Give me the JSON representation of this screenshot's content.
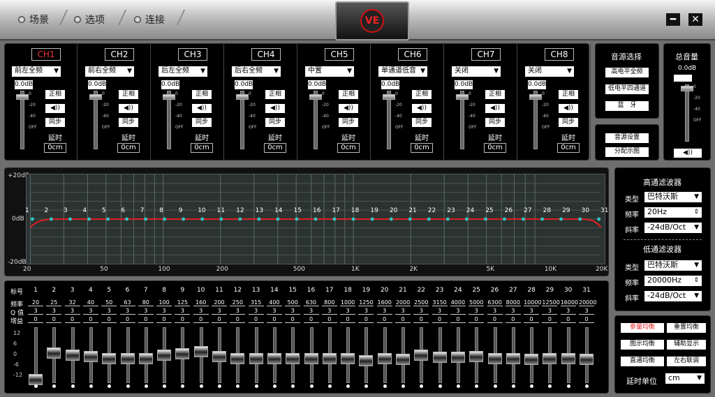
{
  "menu": {
    "items": [
      "场景",
      "选项",
      "连接"
    ]
  },
  "logo_text": "VE",
  "window": {
    "minimize": "━",
    "close": "✕"
  },
  "channels": [
    {
      "name": "CH1",
      "source": "前左全频",
      "db": "0.0dB",
      "selected": true
    },
    {
      "name": "CH2",
      "source": "前右全频",
      "db": "0.0dB",
      "selected": false
    },
    {
      "name": "CH3",
      "source": "后左全频",
      "db": "0.0dB",
      "selected": false
    },
    {
      "name": "CH4",
      "source": "后右全频",
      "db": "0.0dB",
      "selected": false
    },
    {
      "name": "CH5",
      "source": "中置",
      "db": "0.0dB",
      "selected": false
    },
    {
      "name": "CH6",
      "source": "单通道低音",
      "db": "0.0dB",
      "selected": false
    },
    {
      "name": "CH7",
      "source": "关闭",
      "db": "0.0dB",
      "selected": false
    },
    {
      "name": "CH8",
      "source": "关闭",
      "db": "0.0dB",
      "selected": false
    }
  ],
  "channel_buttons": {
    "phase": "正相",
    "mute": "◀))",
    "sync": "同步",
    "delay_label": "延时",
    "delay_value": "0cm"
  },
  "scale": [
    "0",
    "-20",
    "-40",
    "OFF"
  ],
  "source_select": {
    "title": "音源选择",
    "options": [
      "高电平全频",
      "低电平四通道",
      "蓝　牙"
    ]
  },
  "source_extra": [
    "音源设置",
    "分配示图"
  ],
  "master": {
    "title": "总音量",
    "db": "0.0dB",
    "mute": "◀))",
    "scale": [
      "0",
      "-20",
      "-40",
      "OFF"
    ]
  },
  "eq_graph": {
    "y_labels": [
      "+20dB",
      "0dB",
      "-20dB"
    ],
    "x_labels": [
      "20",
      "50",
      "100",
      "200",
      "500",
      "1K",
      "2K",
      "5K",
      "10K",
      "20K"
    ],
    "bands": [
      "1",
      "2",
      "3",
      "4",
      "5",
      "6",
      "7",
      "8",
      "9",
      "10",
      "11",
      "12",
      "13",
      "14",
      "15",
      "16",
      "17",
      "18",
      "19",
      "20",
      "21",
      "22",
      "23",
      "24",
      "25",
      "26",
      "27",
      "28",
      "29",
      "30",
      "31"
    ]
  },
  "highpass": {
    "title": "高通滤波器",
    "type_label": "类型",
    "type": "巴特沃斯",
    "freq_label": "频率",
    "freq": "20Hz",
    "slope_label": "斜率",
    "slope": "-24dB/Oct"
  },
  "lowpass": {
    "title": "低通滤波器",
    "type_label": "类型",
    "type": "巴特沃斯",
    "freq_label": "频率",
    "freq": "20000Hz",
    "slope_label": "斜率",
    "slope": "-24dB/Oct"
  },
  "eq_table": {
    "row_labels": [
      "标号",
      "频率",
      "Q 值",
      "增益"
    ],
    "freqs": [
      "20",
      "25",
      "32",
      "40",
      "50",
      "63",
      "80",
      "100",
      "125",
      "160",
      "200",
      "250",
      "315",
      "400",
      "500",
      "630",
      "800",
      "1000",
      "1250",
      "1600",
      "2000",
      "2500",
      "3150",
      "4000",
      "5000",
      "6300",
      "8000",
      "10000",
      "12500",
      "16000",
      "20000"
    ],
    "q": "3",
    "gain": "0",
    "gain_scale": [
      "12",
      "6",
      "0",
      "-6",
      "-12"
    ],
    "slider_levels": [
      -11,
      1,
      0,
      -0.5,
      -1.5,
      -1.5,
      -1.5,
      0,
      0.5,
      1.5,
      -0.5,
      -1.5,
      -1.5,
      -1.5,
      -1.5,
      -1.5,
      -1.5,
      -1.5,
      -2.5,
      -1.5,
      -2,
      0,
      -1,
      -1,
      -0.5,
      -1.5,
      -1.5,
      -2,
      -1.5,
      -1.5,
      -2
    ]
  },
  "right_buttons": {
    "b1": "参量均衡",
    "b2": "重置均衡",
    "b3": "图示均衡",
    "b4": "辅助显示",
    "b5": "直通均衡",
    "b6": "左右联调"
  },
  "delay_unit": {
    "label": "延时单位",
    "value": "cm"
  },
  "colors": {
    "accent_red": "#e02020",
    "curve": "#e02020",
    "point": "#2ec4c4"
  }
}
